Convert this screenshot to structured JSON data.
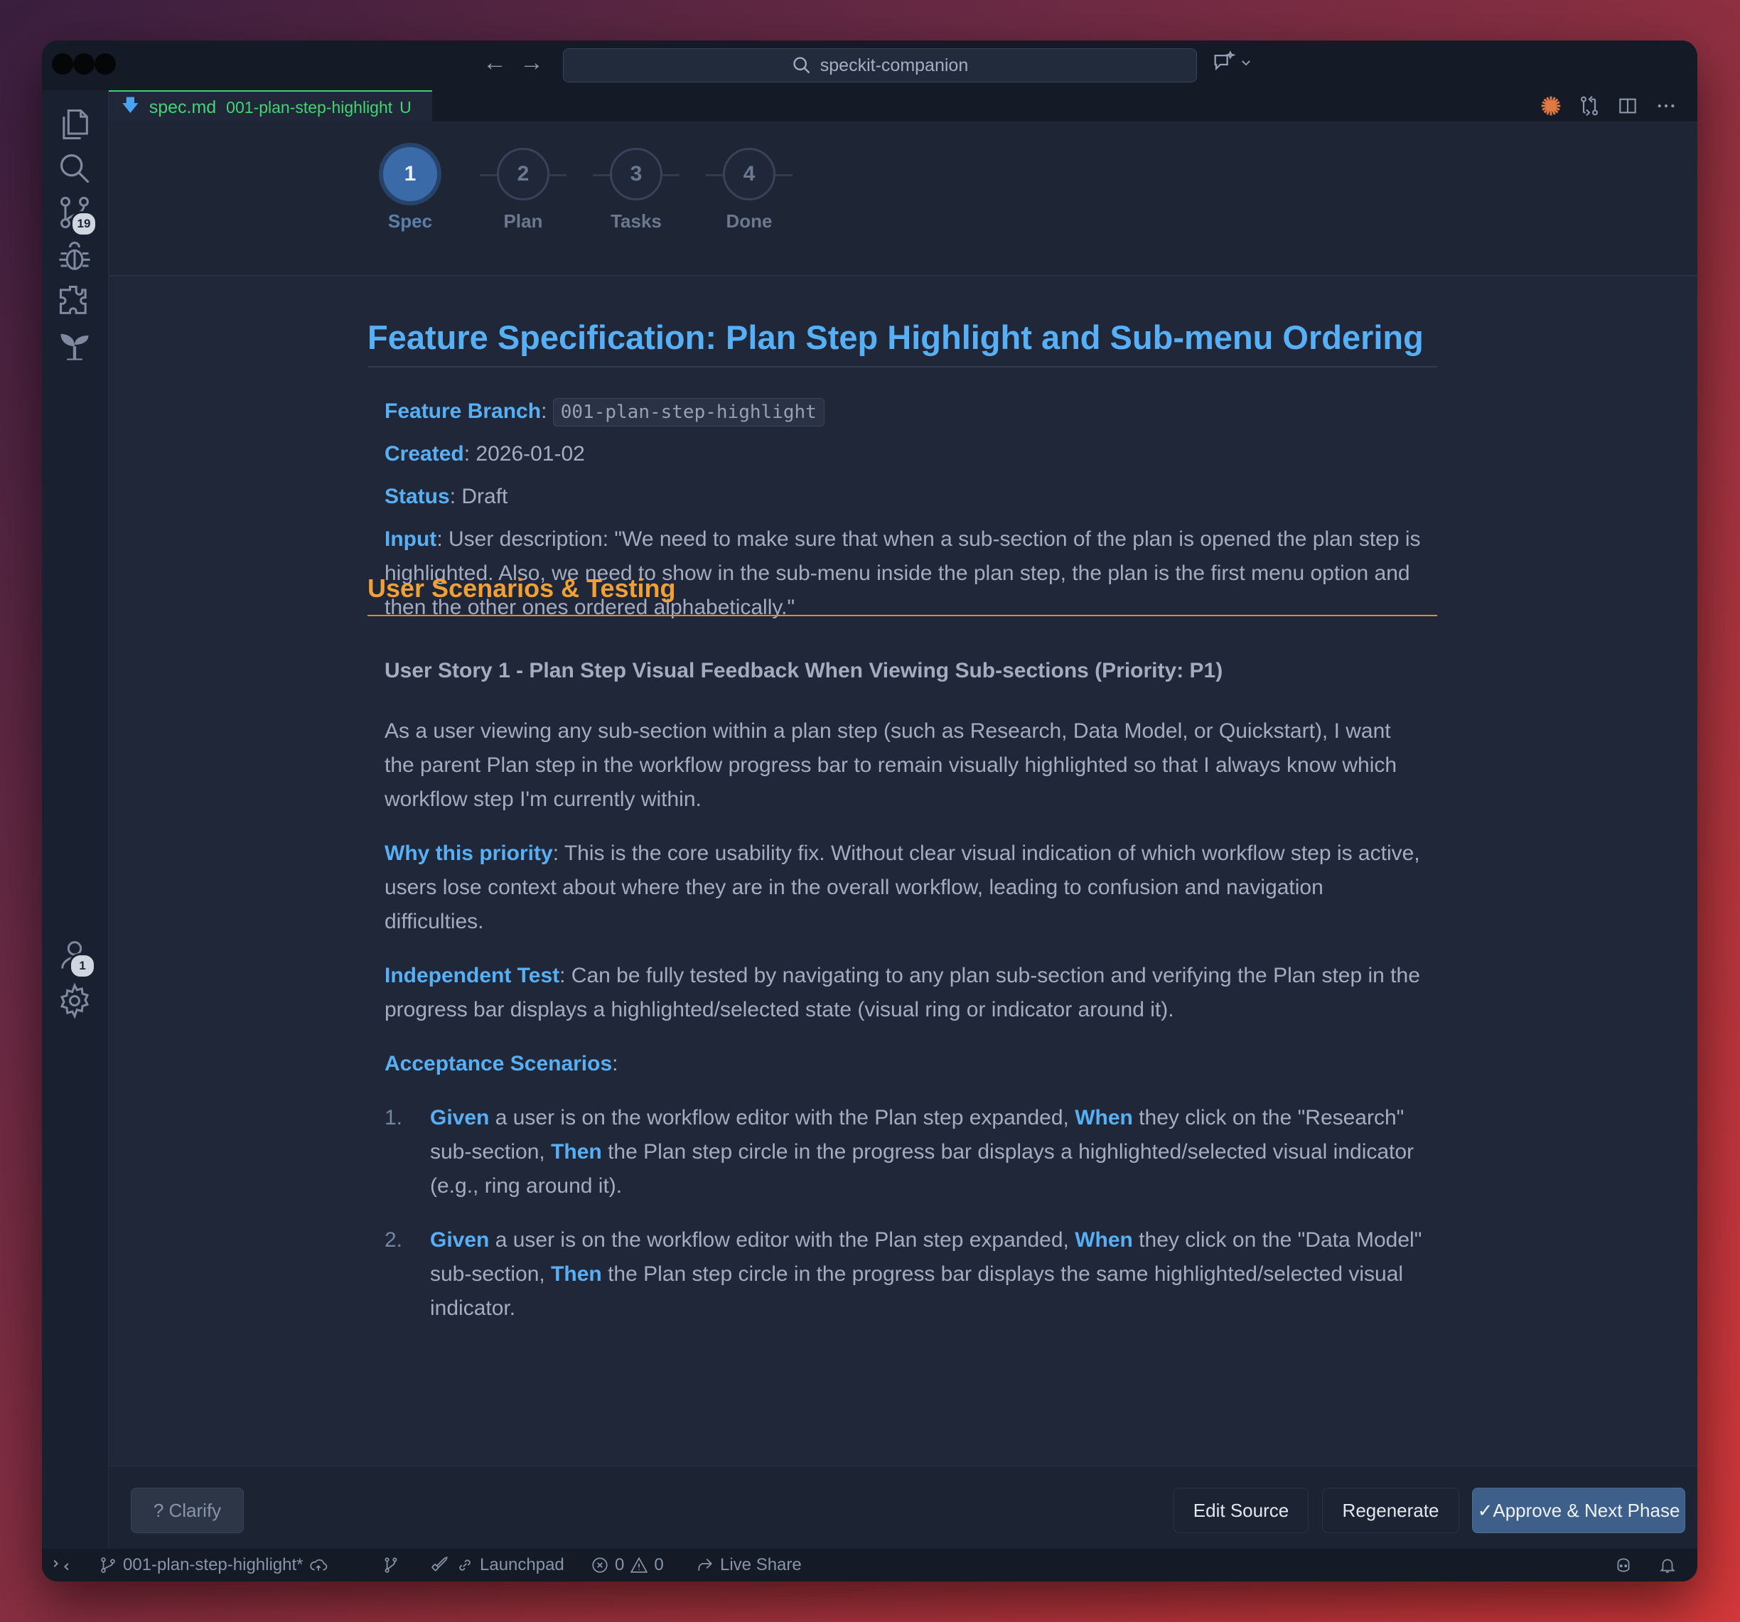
{
  "titlebar": {
    "search_text": "speckit-companion"
  },
  "activity": {
    "source_control_badge": "19",
    "accounts_badge": "1"
  },
  "tab": {
    "filename": "spec.md",
    "branch": "001-plan-step-highlight",
    "modified": "U"
  },
  "stepper": {
    "steps": [
      {
        "num": "1",
        "label": "Spec"
      },
      {
        "num": "2",
        "label": "Plan"
      },
      {
        "num": "3",
        "label": "Tasks"
      },
      {
        "num": "4",
        "label": "Done"
      }
    ]
  },
  "doc": {
    "title": "Feature Specification: Plan Step Highlight and Sub-menu Ordering",
    "meta": {
      "branch_label": "Feature Branch",
      "branch_value": "001-plan-step-highlight",
      "created_label": "Created",
      "created_value": "2026-01-02",
      "status_label": "Status",
      "status_value": "Draft",
      "input_label": "Input",
      "input_value": "User description: \"We need to make sure that when a sub-section of the plan is opened the plan step is highlighted. Also, we need to show in the sub-menu inside the plan step, the plan is the first menu option and then the other ones ordered alphabetically.\""
    },
    "section_heading": "User Scenarios & Testing",
    "story_heading": "User Story 1 - Plan Step Visual Feedback When Viewing Sub-sections (Priority: P1)",
    "story_text": "As a user viewing any sub-section within a plan step (such as Research, Data Model, or Quickstart), I want the parent Plan step in the workflow progress bar to remain visually highlighted so that I always know which workflow step I'm currently within.",
    "why_label": "Why this priority",
    "why_text": "This is the core usability fix. Without clear visual indication of which workflow step is active, users lose context about where they are in the overall workflow, leading to confusion and navigation difficulties.",
    "test_label": "Independent Test",
    "test_text": "Can be fully tested by navigating to any plan sub-section and verifying the Plan step in the progress bar displays a highlighted/selected state (visual ring or indicator around it).",
    "acceptance_label": "Acceptance Scenarios",
    "scenarios": [
      {
        "num": "1.",
        "given": "Given",
        "given_text": " a user is on the workflow editor with the Plan step expanded, ",
        "when": "When",
        "when_text": " they click on the \"Research\" sub-section, ",
        "then": "Then",
        "then_text": " the Plan step circle in the progress bar displays a highlighted/selected visual indicator (e.g., ring around it)."
      },
      {
        "num": "2.",
        "given": "Given",
        "given_text": " a user is on the workflow editor with the Plan step expanded, ",
        "when": "When",
        "when_text": " they click on the \"Data Model\" sub-section, ",
        "then": "Then",
        "then_text": " the Plan step circle in the progress bar displays the same highlighted/selected visual indicator."
      }
    ]
  },
  "actions": {
    "clarify": "? Clarify",
    "edit_source": "Edit Source",
    "regenerate": "Regenerate",
    "approve": "✓Approve & Next Phase"
  },
  "statusbar": {
    "branch": "001-plan-step-highlight*",
    "launchpad": "Launchpad",
    "errors": "0",
    "warnings": "0",
    "live_share": "Live Share"
  },
  "colors": {
    "heading_blue": "#57b0f5",
    "section_orange": "#f0a034",
    "tab_green": "#41d66f",
    "approve_button": "#3f5f8b"
  }
}
